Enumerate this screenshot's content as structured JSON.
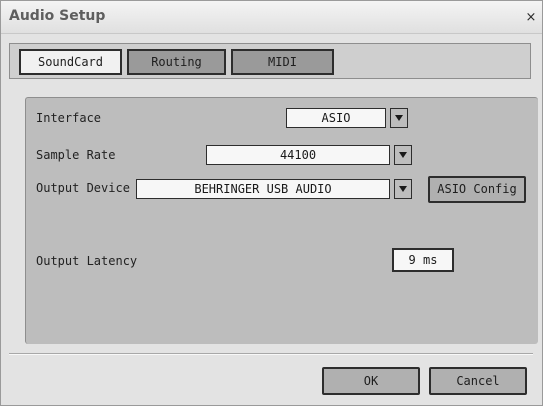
{
  "window": {
    "title": "Audio Setup",
    "close_glyph": "×"
  },
  "tabs": [
    {
      "label": "SoundCard",
      "active": true
    },
    {
      "label": "Routing",
      "active": false
    },
    {
      "label": "MIDI",
      "active": false
    }
  ],
  "soundcard": {
    "interface": {
      "label": "Interface",
      "value": "ASIO"
    },
    "sample_rate": {
      "label": "Sample Rate",
      "value": "44100"
    },
    "output_device": {
      "label": "Output Device",
      "value": "BEHRINGER USB AUDIO"
    },
    "asio_config_label": "ASIO Config",
    "output_latency": {
      "label": "Output Latency",
      "value": "9 ms"
    }
  },
  "footer": {
    "ok_label": "OK",
    "cancel_label": "Cancel"
  },
  "icons": {
    "dropdown": "chevron-down-icon",
    "close": "close-icon"
  }
}
